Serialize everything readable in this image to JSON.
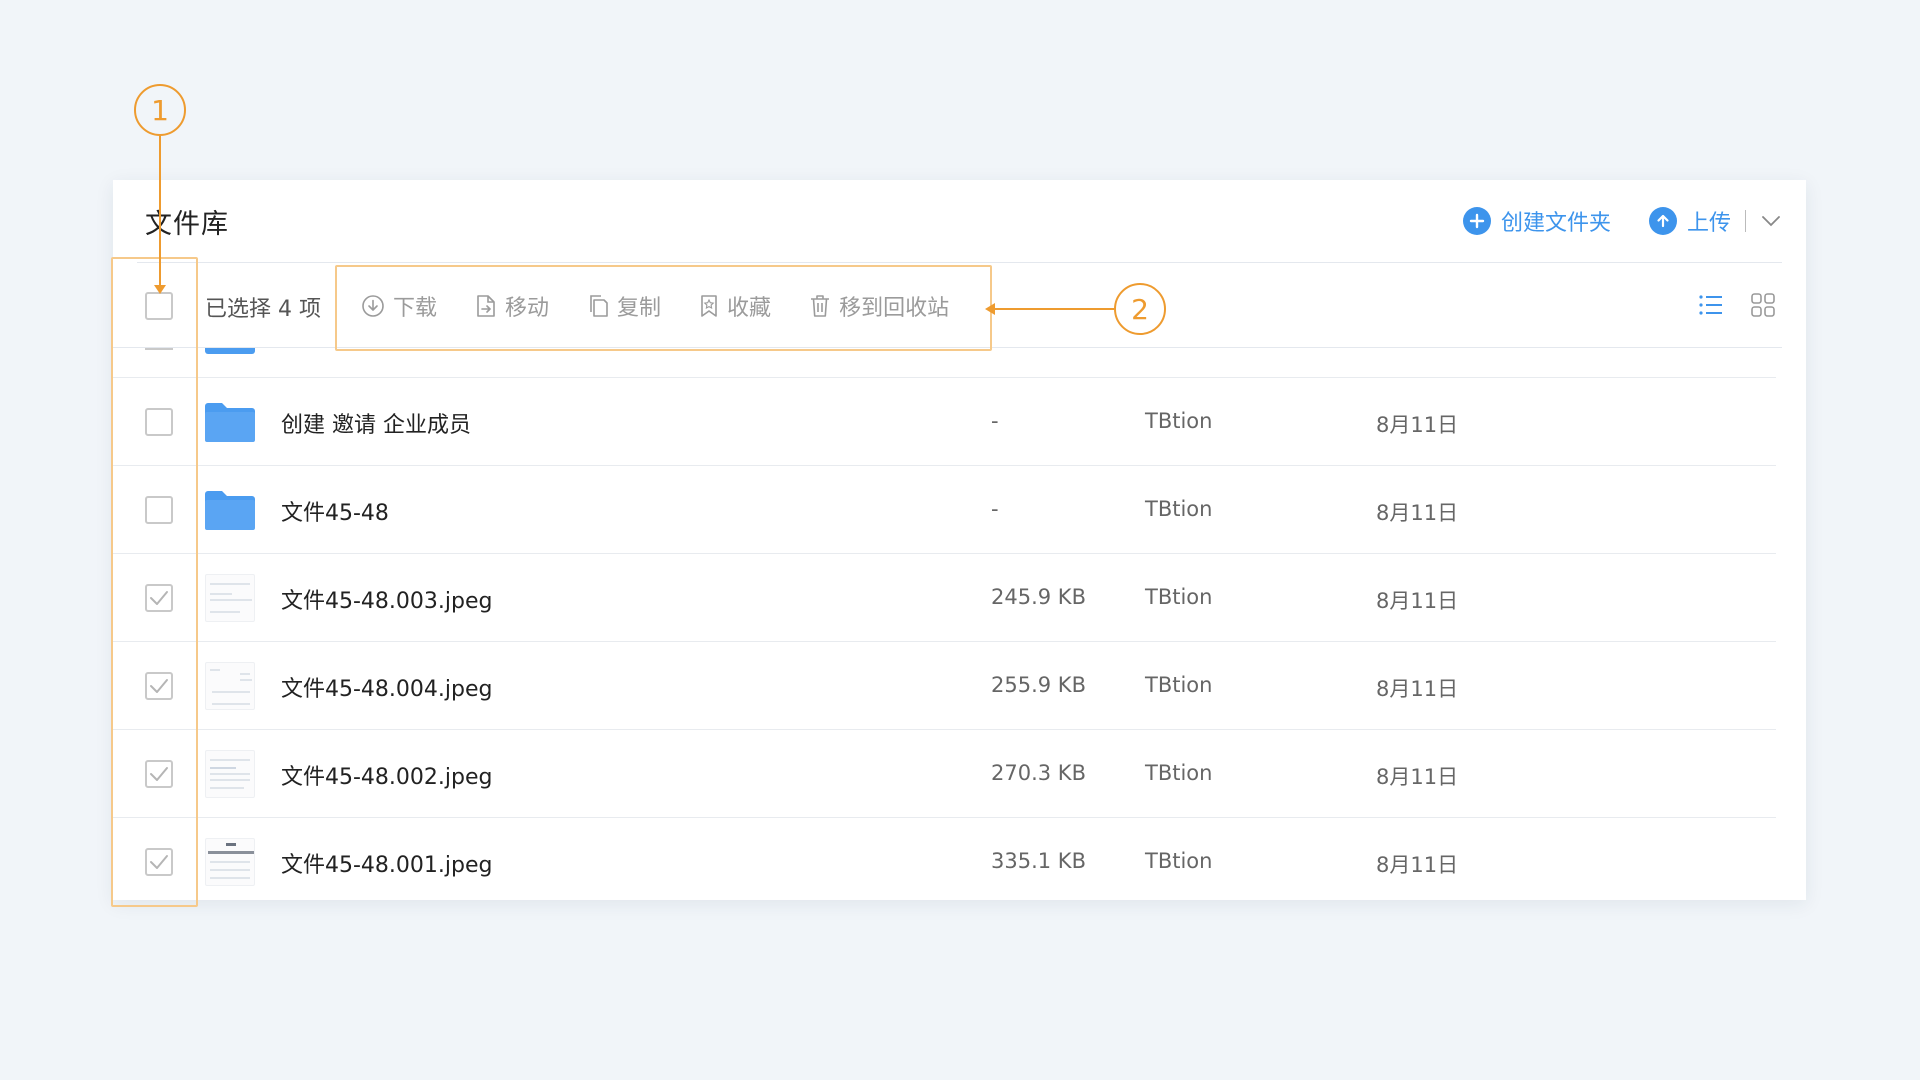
{
  "panel": {
    "title": "文件库",
    "create_folder_label": "创建文件夹",
    "upload_label": "上传"
  },
  "toolbar": {
    "selected_text": "已选择 4 项",
    "actions": {
      "download": "下载",
      "move": "移动",
      "copy": "复制",
      "favorite": "收藏",
      "recycle": "移到回收站"
    }
  },
  "files": [
    {
      "name": "创建 邀请 企业成员",
      "size": "-",
      "owner": "TBtion",
      "date": "8月11日",
      "type": "folder",
      "checked": false
    },
    {
      "name": "文件45-48",
      "size": "-",
      "owner": "TBtion",
      "date": "8月11日",
      "type": "folder",
      "checked": false
    },
    {
      "name": "文件45-48.003.jpeg",
      "size": "245.9 KB",
      "owner": "TBtion",
      "date": "8月11日",
      "type": "image",
      "checked": true
    },
    {
      "name": "文件45-48.004.jpeg",
      "size": "255.9 KB",
      "owner": "TBtion",
      "date": "8月11日",
      "type": "image",
      "checked": true
    },
    {
      "name": "文件45-48.002.jpeg",
      "size": "270.3 KB",
      "owner": "TBtion",
      "date": "8月11日",
      "type": "image",
      "checked": true
    },
    {
      "name": "文件45-48.001.jpeg",
      "size": "335.1 KB",
      "owner": "TBtion",
      "date": "8月11日",
      "type": "image",
      "checked": true
    }
  ],
  "annotations": {
    "marker_1": "1",
    "marker_2": "2"
  },
  "colors": {
    "accent": "#3d94ec",
    "annotation": "#ee9b2f",
    "folder": "#4b9cf0"
  },
  "icons": {
    "create_folder": "plus-circle-icon",
    "upload": "upload-circle-icon",
    "dropdown": "chevron-down-icon",
    "download": "download-icon",
    "move": "file-move-icon",
    "copy": "copy-icon",
    "favorite": "star-icon",
    "recycle": "trash-icon",
    "list_view": "list-view-icon",
    "grid_view": "grid-view-icon"
  }
}
